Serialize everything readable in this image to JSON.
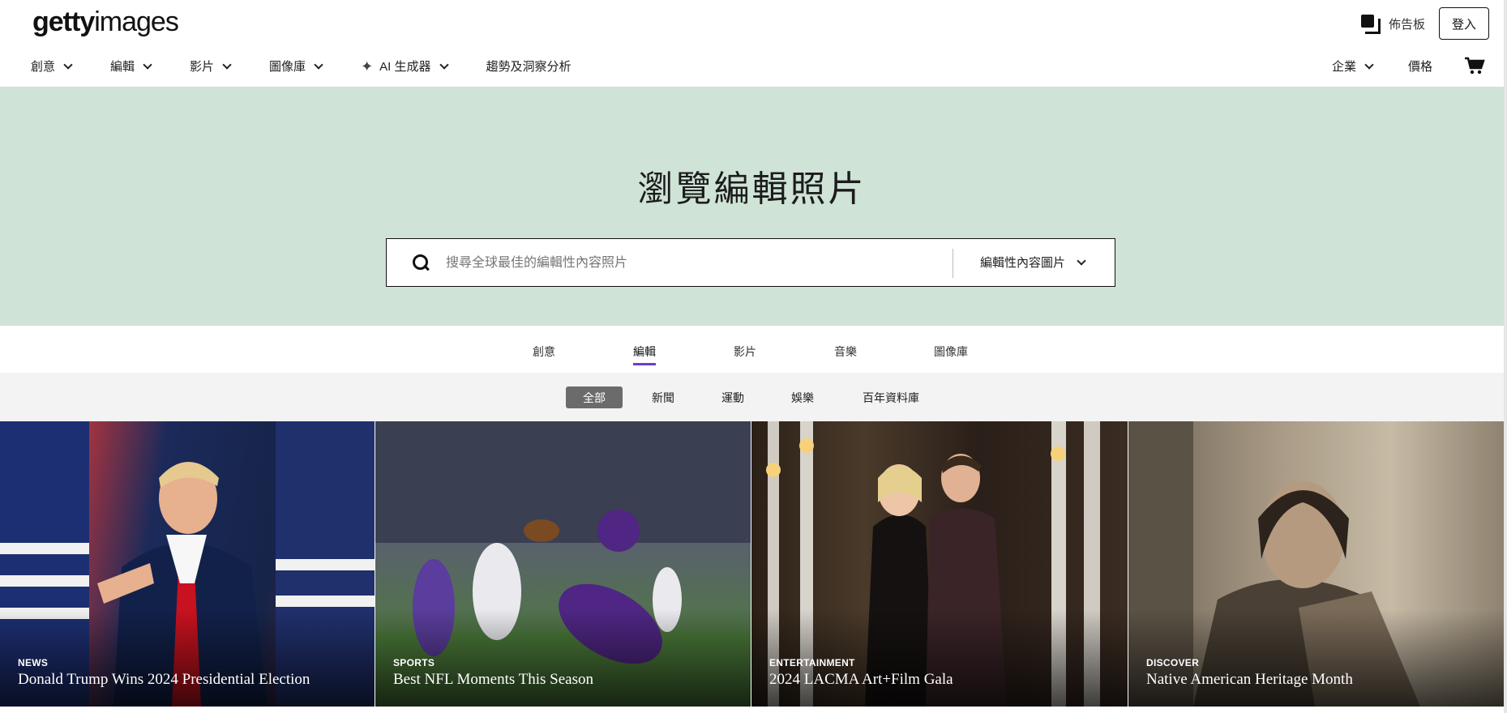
{
  "header": {
    "logo_bold": "getty",
    "logo_light": "images",
    "board_label": "佈告板",
    "login_label": "登入",
    "nav": [
      {
        "label": "創意"
      },
      {
        "label": "編輯"
      },
      {
        "label": "影片"
      },
      {
        "label": "圖像庫"
      },
      {
        "label": "AI 生成器"
      },
      {
        "label": "趨勢及洞察分析"
      }
    ],
    "enterprise_label": "企業",
    "pricing_label": "價格"
  },
  "hero": {
    "title": "瀏覽編輯照片",
    "search_placeholder": "搜尋全球最佳的編輯性內容照片",
    "scope_label": "編輯性內容圖片"
  },
  "category_tabs": [
    {
      "label": "創意"
    },
    {
      "label": "編輯"
    },
    {
      "label": "影片"
    },
    {
      "label": "音樂"
    },
    {
      "label": "圖像庫"
    }
  ],
  "active_category": "編輯",
  "sub_tabs": [
    {
      "label": "全部"
    },
    {
      "label": "新聞"
    },
    {
      "label": "運動"
    },
    {
      "label": "娛樂"
    },
    {
      "label": "百年資料庫"
    }
  ],
  "active_sub_tab": "全部",
  "tiles": [
    {
      "category": "NEWS",
      "title": "Donald Trump Wins 2024 Presidential Election"
    },
    {
      "category": "SPORTS",
      "title": "Best NFL Moments This Season"
    },
    {
      "category": "ENTERTAINMENT",
      "title": "2024 LACMA Art+Film Gala"
    },
    {
      "category": "DISCOVER",
      "title": "Native American Heritage Month"
    }
  ],
  "colors": {
    "hero_bg": "#cfe3d7",
    "active_tab_underline": "#6a3fc7",
    "active_subtab_bg": "#6b6b6b"
  }
}
